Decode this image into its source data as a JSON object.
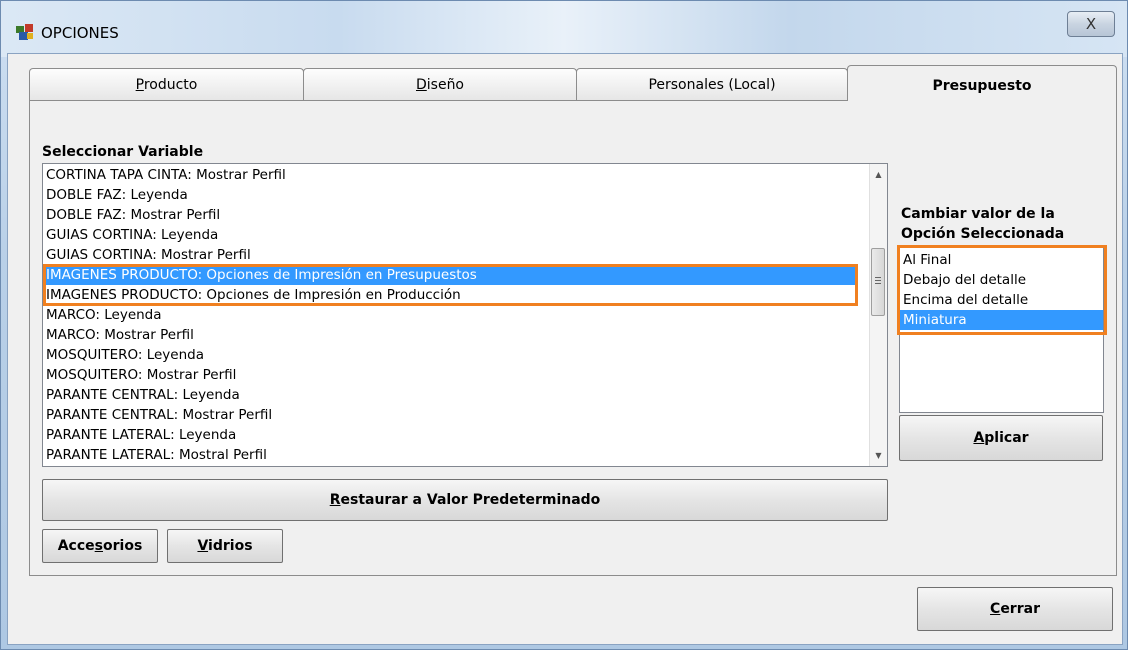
{
  "window": {
    "title": "OPCIONES",
    "close_label": "X"
  },
  "tabs": [
    {
      "label": "Producto",
      "underline": "P",
      "rest": "roducto",
      "active": false
    },
    {
      "label": "Diseño",
      "underline": "D",
      "rest": "iseño",
      "active": false
    },
    {
      "label": "Personales (Local)",
      "active": false
    },
    {
      "label": "Presupuesto",
      "active": true
    }
  ],
  "variables": {
    "label": "Seleccionar Variable",
    "items": [
      "CORTINA TAPA CINTA: Mostrar Perfil",
      "DOBLE FAZ: Leyenda",
      "DOBLE FAZ: Mostrar Perfil",
      "GUIAS CORTINA: Leyenda",
      "GUIAS CORTINA: Mostrar Perfil",
      "IMAGENES PRODUCTO: Opciones de Impresión en Presupuestos",
      "IMAGENES PRODUCTO: Opciones de Impresión en Producción",
      "MARCO: Leyenda",
      "MARCO: Mostrar Perfil",
      "MOSQUITERO: Leyenda",
      "MOSQUITERO: Mostrar Perfil",
      "PARANTE CENTRAL: Leyenda",
      "PARANTE CENTRAL: Mostrar Perfil",
      "PARANTE LATERAL: Leyenda",
      "PARANTE LATERAL: Mostral Perfil"
    ],
    "selected_index": 5
  },
  "options": {
    "label_line1": "Cambiar valor de la",
    "label_line2": "Opción Seleccionada",
    "items": [
      "Al Final",
      "Debajo del detalle",
      "Encima del detalle",
      "Miniatura"
    ],
    "selected_index": 3
  },
  "buttons": {
    "apply": {
      "u": "A",
      "rest": "plicar"
    },
    "restore": {
      "u": "R",
      "rest": "estaurar a Valor Predeterminado"
    },
    "accessories": {
      "pre": "Acce",
      "u": "s",
      "post": "orios"
    },
    "glass": {
      "u": "V",
      "rest": "idrios"
    },
    "close": {
      "u": "C",
      "rest": "errar"
    }
  },
  "colors": {
    "selection": "#3399ff",
    "highlight_border": "#f08020"
  }
}
